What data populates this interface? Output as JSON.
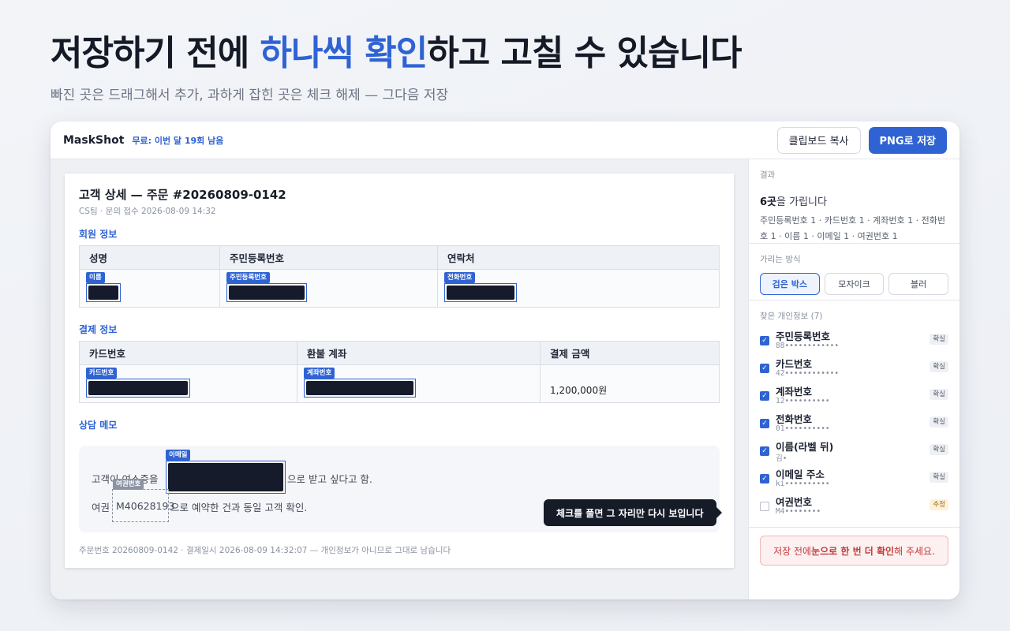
{
  "hero": {
    "title_before": "저장하기 전에 ",
    "title_accent": "하나씩 확인",
    "title_after": "하고 고칠 수 있습니다",
    "subtitle": "빠진 곳은 드래그해서 추가, 과하게 잡힌 곳은 체크 해제 — 그다음 저장"
  },
  "app": {
    "name": "MaskShot",
    "quota": "무료: 이번 달 19회 남음",
    "copy_button": "클립보드 복사",
    "save_button": "PNG로 저장"
  },
  "document": {
    "title": "고객 상세 — 주문 #20260809-0142",
    "meta": "CS팀 · 문의 접수 2026-08-09 14:32",
    "member_section": "회원 정보",
    "member_headers": [
      "성명",
      "주민등록번호",
      "연락처"
    ],
    "member_tags": [
      "이름",
      "주민등록번호",
      "전화번호"
    ],
    "payment_section": "결제 정보",
    "payment_headers": [
      "카드번호",
      "환불 계좌",
      "결제 금액"
    ],
    "payment_tags": [
      "카드번호",
      "계좌번호"
    ],
    "amount": "1,200,000원",
    "memo_section": "상담 메모",
    "memo_line1_before": "고객이 여스증을",
    "memo_email_tag": "이메일",
    "memo_line1_after": "으로 받고 싶다고 함.",
    "memo_line2_before": "여권",
    "memo_passport_tag": "여권번호",
    "memo_passport": "M40628193",
    "memo_line2_after": "으로 예약한 건과 동일 고객 확인.",
    "footer": "주문번호 20260809-0142 · 결제일시 2026-08-09 14:32:07 — 개인정보가 아니므로 그대로 남습니다"
  },
  "tooltip": "체크를 풀면 그 자리만 다시 보입니다",
  "panel": {
    "result_label": "결과",
    "result_count": "6곳",
    "result_text": "을 가립니다",
    "result_summary": "주민등록번호 1 · 카드번호 1 · 계좌번호 1 · 전화번호 1 · 이름 1 · 이메일 1 · 여권번호 1",
    "method_label": "가리는 방식",
    "methods": [
      "검은 박스",
      "모자이크",
      "블러"
    ],
    "active_method": "검은 박스",
    "found_label": "찾은 개인정보 (7)",
    "items": [
      {
        "name": "주민등록번호",
        "mask": "88••••••••••••",
        "badge": "확실",
        "checked": true
      },
      {
        "name": "카드번호",
        "mask": "42••••••••••••",
        "badge": "확실",
        "checked": true
      },
      {
        "name": "계좌번호",
        "mask": "12••••••••••",
        "badge": "확실",
        "checked": true
      },
      {
        "name": "전화번호",
        "mask": "01••••••••••",
        "badge": "확실",
        "checked": true
      },
      {
        "name": "이름(라벨 뒤)",
        "mask": "김•",
        "badge": "확실",
        "checked": true
      },
      {
        "name": "이메일 주소",
        "mask": "ki••••••••••",
        "badge": "확실",
        "checked": true
      },
      {
        "name": "여권번호",
        "mask": "M4••••••••",
        "badge": "추정",
        "checked": false
      }
    ],
    "warning_before": "저장 전에 ",
    "warning_bold": "눈으로 한 번 더 확인",
    "warning_after": "해 주세요."
  },
  "colors": {
    "accent": "#2f63d3",
    "redaction": "#161b2b",
    "warning": "#c23a3a"
  }
}
